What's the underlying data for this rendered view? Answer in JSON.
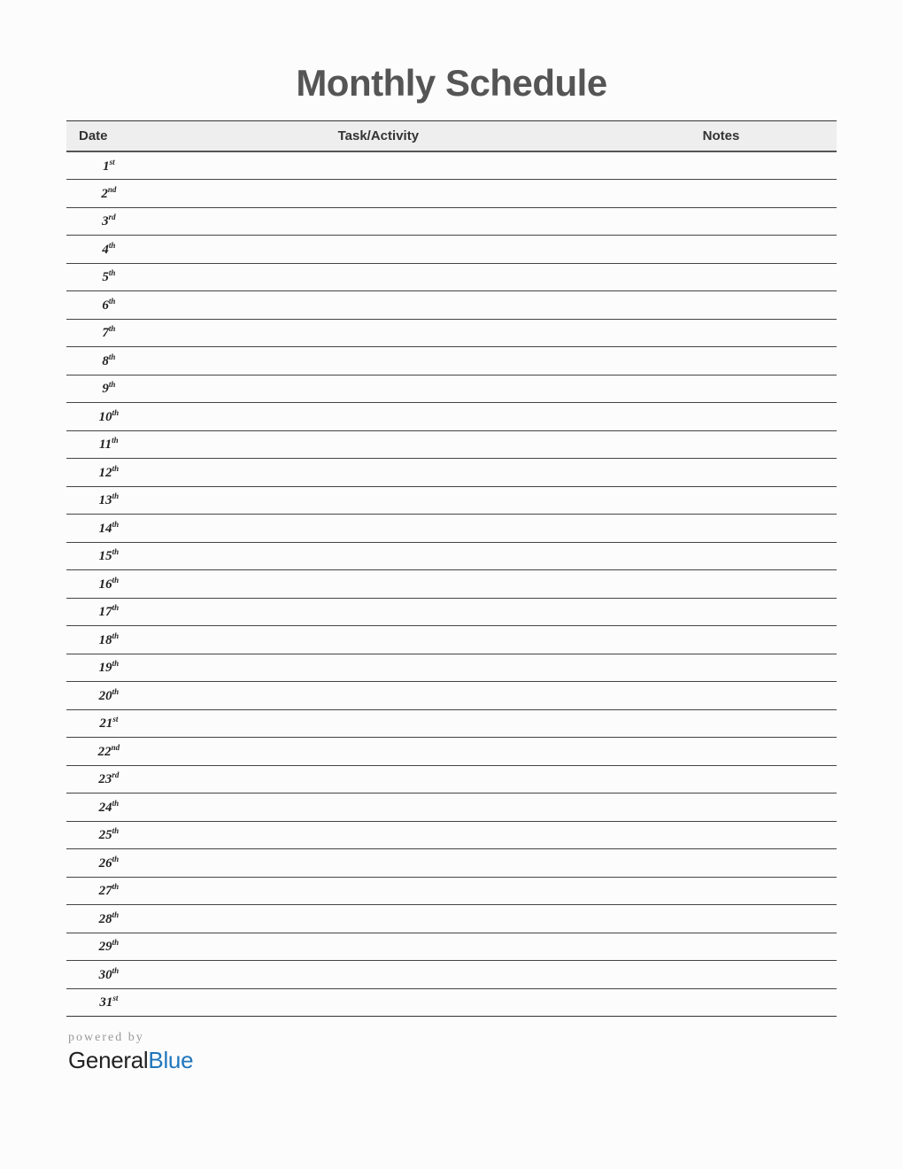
{
  "title": "Monthly Schedule",
  "columns": {
    "date": "Date",
    "task": "Task/Activity",
    "notes": "Notes"
  },
  "rows": [
    {
      "num": "1",
      "suffix": "st",
      "task": "",
      "notes": ""
    },
    {
      "num": "2",
      "suffix": "nd",
      "task": "",
      "notes": ""
    },
    {
      "num": "3",
      "suffix": "rd",
      "task": "",
      "notes": ""
    },
    {
      "num": "4",
      "suffix": "th",
      "task": "",
      "notes": ""
    },
    {
      "num": "5",
      "suffix": "th",
      "task": "",
      "notes": ""
    },
    {
      "num": "6",
      "suffix": "th",
      "task": "",
      "notes": ""
    },
    {
      "num": "7",
      "suffix": "th",
      "task": "",
      "notes": ""
    },
    {
      "num": "8",
      "suffix": "th",
      "task": "",
      "notes": ""
    },
    {
      "num": "9",
      "suffix": "th",
      "task": "",
      "notes": ""
    },
    {
      "num": "10",
      "suffix": "th",
      "task": "",
      "notes": ""
    },
    {
      "num": "11",
      "suffix": "th",
      "task": "",
      "notes": ""
    },
    {
      "num": "12",
      "suffix": "th",
      "task": "",
      "notes": ""
    },
    {
      "num": "13",
      "suffix": "th",
      "task": "",
      "notes": ""
    },
    {
      "num": "14",
      "suffix": "th",
      "task": "",
      "notes": ""
    },
    {
      "num": "15",
      "suffix": "th",
      "task": "",
      "notes": ""
    },
    {
      "num": "16",
      "suffix": "th",
      "task": "",
      "notes": ""
    },
    {
      "num": "17",
      "suffix": "th",
      "task": "",
      "notes": ""
    },
    {
      "num": "18",
      "suffix": "th",
      "task": "",
      "notes": ""
    },
    {
      "num": "19",
      "suffix": "th",
      "task": "",
      "notes": ""
    },
    {
      "num": "20",
      "suffix": "th",
      "task": "",
      "notes": ""
    },
    {
      "num": "21",
      "suffix": "st",
      "task": "",
      "notes": ""
    },
    {
      "num": "22",
      "suffix": "nd",
      "task": "",
      "notes": ""
    },
    {
      "num": "23",
      "suffix": "rd",
      "task": "",
      "notes": ""
    },
    {
      "num": "24",
      "suffix": "th",
      "task": "",
      "notes": ""
    },
    {
      "num": "25",
      "suffix": "th",
      "task": "",
      "notes": ""
    },
    {
      "num": "26",
      "suffix": "th",
      "task": "",
      "notes": ""
    },
    {
      "num": "27",
      "suffix": "th",
      "task": "",
      "notes": ""
    },
    {
      "num": "28",
      "suffix": "th",
      "task": "",
      "notes": ""
    },
    {
      "num": "29",
      "suffix": "th",
      "task": "",
      "notes": ""
    },
    {
      "num": "30",
      "suffix": "th",
      "task": "",
      "notes": ""
    },
    {
      "num": "31",
      "suffix": "st",
      "task": "",
      "notes": ""
    }
  ],
  "footer": {
    "powered": "powered by",
    "brand1": "General",
    "brand2": "Blue"
  }
}
